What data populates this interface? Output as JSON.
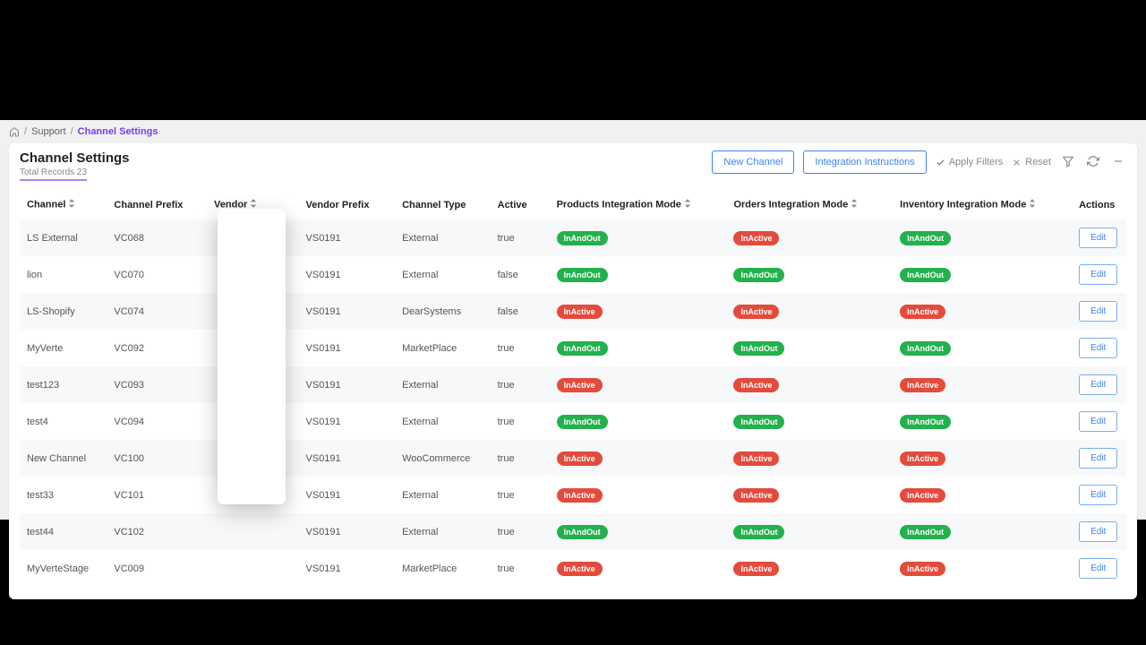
{
  "breadcrumb": {
    "home_label": "Home",
    "support": "Support",
    "current": "Channel Settings"
  },
  "header": {
    "title": "Channel Settings",
    "subtitle": "Total Records 23",
    "new_channel": "New Channel",
    "integration_instructions": "Integration Instructions",
    "apply_filters": "Apply Filters",
    "reset": "Reset"
  },
  "columns": {
    "channel": "Channel",
    "channel_prefix": "Channel Prefix",
    "vendor": "Vendor",
    "vendor_prefix": "Vendor Prefix",
    "channel_type": "Channel Type",
    "active": "Active",
    "products_mode": "Products Integration Mode",
    "orders_mode": "Orders Integration Mode",
    "inventory_mode": "Inventory Integration Mode",
    "actions": "Actions"
  },
  "edit_label": "Edit",
  "badge_labels": {
    "InAndOut": "InAndOut",
    "InActive": "InActive"
  },
  "rows": [
    {
      "channel": "LS External",
      "channel_prefix": "VC068",
      "vendor": "",
      "vendor_prefix": "VS0191",
      "channel_type": "External",
      "active": "true",
      "products": "InAndOut",
      "orders": "InActive",
      "inventory": "InAndOut"
    },
    {
      "channel": "lion",
      "channel_prefix": "VC070",
      "vendor": "",
      "vendor_prefix": "VS0191",
      "channel_type": "External",
      "active": "false",
      "products": "InAndOut",
      "orders": "InAndOut",
      "inventory": "InAndOut"
    },
    {
      "channel": "LS-Shopify",
      "channel_prefix": "VC074",
      "vendor": "",
      "vendor_prefix": "VS0191",
      "channel_type": "DearSystems",
      "active": "false",
      "products": "InActive",
      "orders": "InActive",
      "inventory": "InActive"
    },
    {
      "channel": "MyVerte",
      "channel_prefix": "VC092",
      "vendor": "",
      "vendor_prefix": "VS0191",
      "channel_type": "MarketPlace",
      "active": "true",
      "products": "InAndOut",
      "orders": "InAndOut",
      "inventory": "InAndOut"
    },
    {
      "channel": "test123",
      "channel_prefix": "VC093",
      "vendor": "",
      "vendor_prefix": "VS0191",
      "channel_type": "External",
      "active": "true",
      "products": "InActive",
      "orders": "InActive",
      "inventory": "InActive"
    },
    {
      "channel": "test4",
      "channel_prefix": "VC094",
      "vendor": "",
      "vendor_prefix": "VS0191",
      "channel_type": "External",
      "active": "true",
      "products": "InAndOut",
      "orders": "InAndOut",
      "inventory": "InAndOut"
    },
    {
      "channel": "New Channel",
      "channel_prefix": "VC100",
      "vendor": "",
      "vendor_prefix": "VS0191",
      "channel_type": "WooCommerce",
      "active": "true",
      "products": "InActive",
      "orders": "InActive",
      "inventory": "InActive"
    },
    {
      "channel": "test33",
      "channel_prefix": "VC101",
      "vendor": "",
      "vendor_prefix": "VS0191",
      "channel_type": "External",
      "active": "true",
      "products": "InActive",
      "orders": "InActive",
      "inventory": "InActive"
    },
    {
      "channel": "test44",
      "channel_prefix": "VC102",
      "vendor": "",
      "vendor_prefix": "VS0191",
      "channel_type": "External",
      "active": "true",
      "products": "InAndOut",
      "orders": "InAndOut",
      "inventory": "InAndOut"
    },
    {
      "channel": "MyVerteStage",
      "channel_prefix": "VC009",
      "vendor": "",
      "vendor_prefix": "VS0191",
      "channel_type": "MarketPlace",
      "active": "true",
      "products": "InActive",
      "orders": "InActive",
      "inventory": "InActive"
    }
  ]
}
